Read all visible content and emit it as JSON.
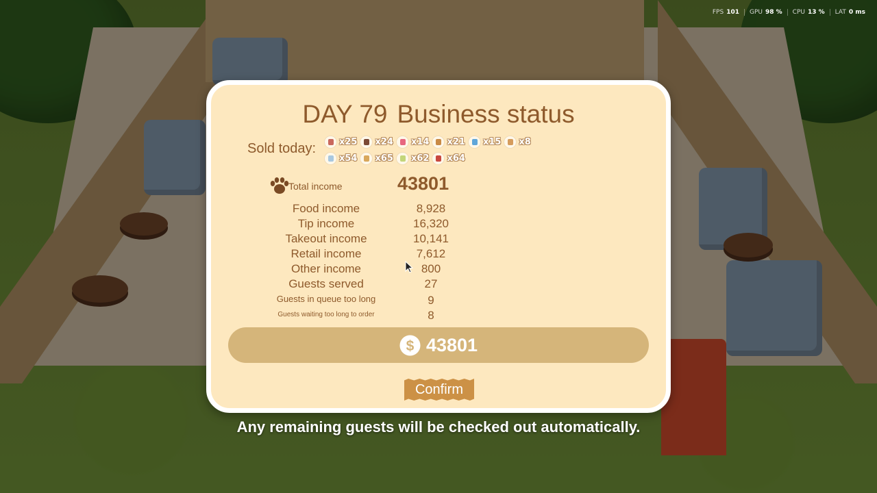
{
  "hud": {
    "fps_label": "FPS",
    "fps_value": "101",
    "gpu_label": "GPU",
    "gpu_value": "98 %",
    "cpu_label": "CPU",
    "cpu_value": "13 %",
    "lat_label": "LAT",
    "lat_value": "0 ms"
  },
  "dialog": {
    "day": "DAY 79",
    "title": "Business status",
    "sold_label": "Sold today:",
    "sold_items": [
      {
        "icon": "cake-icon",
        "count": "x25",
        "color": "#c9685d"
      },
      {
        "icon": "donut-icon",
        "count": "x24",
        "color": "#7b4a35"
      },
      {
        "icon": "pink-drink-icon",
        "count": "x14",
        "color": "#e7677f"
      },
      {
        "icon": "bread-icon",
        "count": "x21",
        "color": "#c98a45"
      },
      {
        "icon": "blue-drink-icon",
        "count": "x15",
        "color": "#5fa6d9"
      },
      {
        "icon": "coffee-cup-icon",
        "count": "x8",
        "color": "#d59c5c"
      },
      {
        "icon": "milk-icon",
        "count": "x54",
        "color": "#a9c8df"
      },
      {
        "icon": "toast-icon",
        "count": "x65",
        "color": "#d9a85c"
      },
      {
        "icon": "matcha-icon",
        "count": "x62",
        "color": "#c3d67a"
      },
      {
        "icon": "soda-bottle-icon",
        "count": "x64",
        "color": "#c9483f"
      }
    ],
    "total_income_label": "Total income",
    "total_income_value": "43801",
    "rows": [
      {
        "label": "Food income",
        "value": "8,928"
      },
      {
        "label": "Tip income",
        "value": "16,320"
      },
      {
        "label": "Takeout income",
        "value": "10,141"
      },
      {
        "label": "Retail income",
        "value": "7,612"
      },
      {
        "label": "Other income",
        "value": "800"
      },
      {
        "label": "Guests served",
        "value": "27"
      },
      {
        "label": "Guests in queue too long",
        "value": "9"
      },
      {
        "label": "Guests waiting too long to order",
        "value": "8"
      }
    ],
    "balance_value": "43801",
    "confirm_label": "Confirm"
  },
  "footer_message": "Any remaining guests will be checked out automatically.",
  "colors": {
    "panel_bg": "#fde8bf",
    "text_brown": "#8e5a2c",
    "bar_bg": "#d5b57a",
    "confirm_bg": "#cc9146"
  }
}
